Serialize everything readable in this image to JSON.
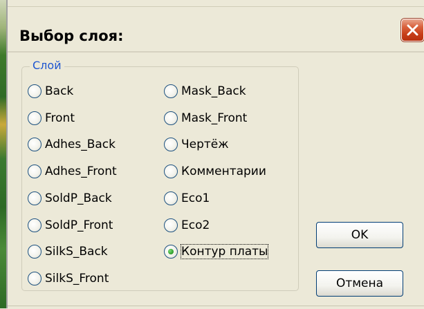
{
  "dialog": {
    "title": "Выбор слоя:",
    "group_label": "Слой",
    "layers_left": [
      {
        "label": "Back",
        "checked": false
      },
      {
        "label": "Front",
        "checked": false
      },
      {
        "label": "Adhes_Back",
        "checked": false
      },
      {
        "label": "Adhes_Front",
        "checked": false
      },
      {
        "label": "SoldP_Back",
        "checked": false
      },
      {
        "label": "SoldP_Front",
        "checked": false
      },
      {
        "label": "SilkS_Back",
        "checked": false
      },
      {
        "label": "SilkS_Front",
        "checked": false
      }
    ],
    "layers_right": [
      {
        "label": "Mask_Back",
        "checked": false
      },
      {
        "label": "Mask_Front",
        "checked": false
      },
      {
        "label": "Чертёж",
        "checked": false
      },
      {
        "label": "Комментарии",
        "checked": false
      },
      {
        "label": "Eco1",
        "checked": false
      },
      {
        "label": "Eco2",
        "checked": false
      },
      {
        "label": "Контур платы",
        "checked": true
      }
    ],
    "ok_label": "OK",
    "cancel_label": "Отмена"
  },
  "colors": {
    "window_bg": "#ece9d8",
    "group_label": "#1e56d0",
    "close_button": "#c63d18",
    "radio_checked": "#3fae3a"
  },
  "icons": {
    "close": "close-icon"
  }
}
